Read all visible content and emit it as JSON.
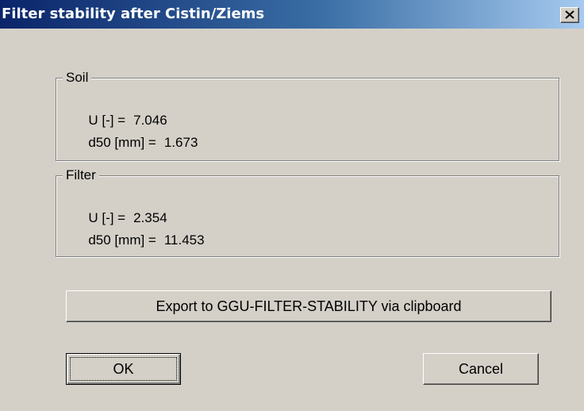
{
  "window": {
    "title": "Filter stability after Cistin/Ziems",
    "close_icon": "close-icon"
  },
  "soil": {
    "legend": "Soil",
    "u_label": "U [-] =",
    "u_value": "7.046",
    "d50_label": "d50 [mm] =",
    "d50_value": "1.673"
  },
  "filter": {
    "legend": "Filter",
    "u_label": "U [-] =",
    "u_value": "2.354",
    "d50_label": "d50 [mm] =",
    "d50_value": "11.453"
  },
  "buttons": {
    "export": "Export to GGU-FILTER-STABILITY via clipboard",
    "ok": "OK",
    "cancel": "Cancel"
  }
}
